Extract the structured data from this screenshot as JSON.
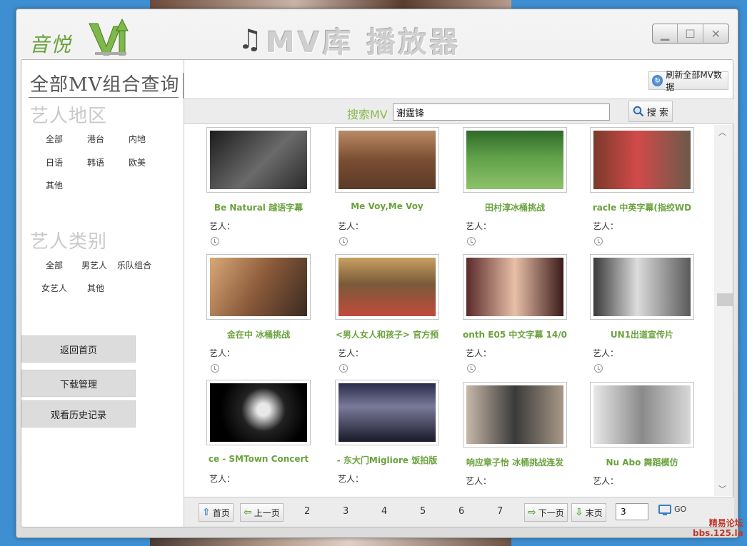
{
  "app": {
    "logo_text": "音悦",
    "title": "MV库 播放器"
  },
  "left_panel": {
    "title": "全部MV组合查询",
    "region_heading": "艺人地区",
    "regions": [
      "全部",
      "港台",
      "内地",
      "日语",
      "韩语",
      "欧美",
      "其他"
    ],
    "type_heading": "艺人类别",
    "types": [
      "全部",
      "男艺人",
      "乐队组合",
      "女艺人",
      "其他"
    ],
    "nav_buttons": [
      "返回首页",
      "下载管理",
      "观看历史记录"
    ]
  },
  "toolbar": {
    "refresh_label": "刷新全部MV数据"
  },
  "search": {
    "label": "搜索MV",
    "value": "谢霆锋",
    "button_label": "搜 索"
  },
  "artist_prefix": "艺人：",
  "cards": [
    {
      "title": "Be Natural 越语字幕",
      "artist_label": "艺人："
    },
    {
      "title": "Me Voy,Me Voy",
      "artist_label": "艺人："
    },
    {
      "title": "田村淳冰桶挑战",
      "artist_label": "艺人："
    },
    {
      "title": "racle 中英字幕(指绞WD",
      "artist_label": "艺人："
    },
    {
      "title": "金在中 冰桶挑战",
      "artist_label": "艺人："
    },
    {
      "title": "<男人女人和孩子> 官方预",
      "artist_label": "艺人："
    },
    {
      "title": "onth E05 中文字幕 14/0",
      "artist_label": "艺人："
    },
    {
      "title": "UN1出道宣传片",
      "artist_label": "艺人："
    },
    {
      "title": "ce - SMTown Concert",
      "artist_label": "艺人："
    },
    {
      "title": "- 东大门Migliore 饭拍版",
      "artist_label": "艺人："
    },
    {
      "title": "响应章子怡 冰桶挑战连发",
      "artist_label": "艺人："
    },
    {
      "title": "Nu Abo 舞蹈模仿",
      "artist_label": "艺人："
    }
  ],
  "pager": {
    "first": "首页",
    "prev": "上一页",
    "pages": [
      "2",
      "3",
      "4",
      "5",
      "6",
      "7"
    ],
    "next": "下一页",
    "last": "末页",
    "jump_value": "3",
    "go_label": "GO"
  },
  "watermark": {
    "line1": "精易论坛",
    "line2": "bbs.125.la"
  }
}
